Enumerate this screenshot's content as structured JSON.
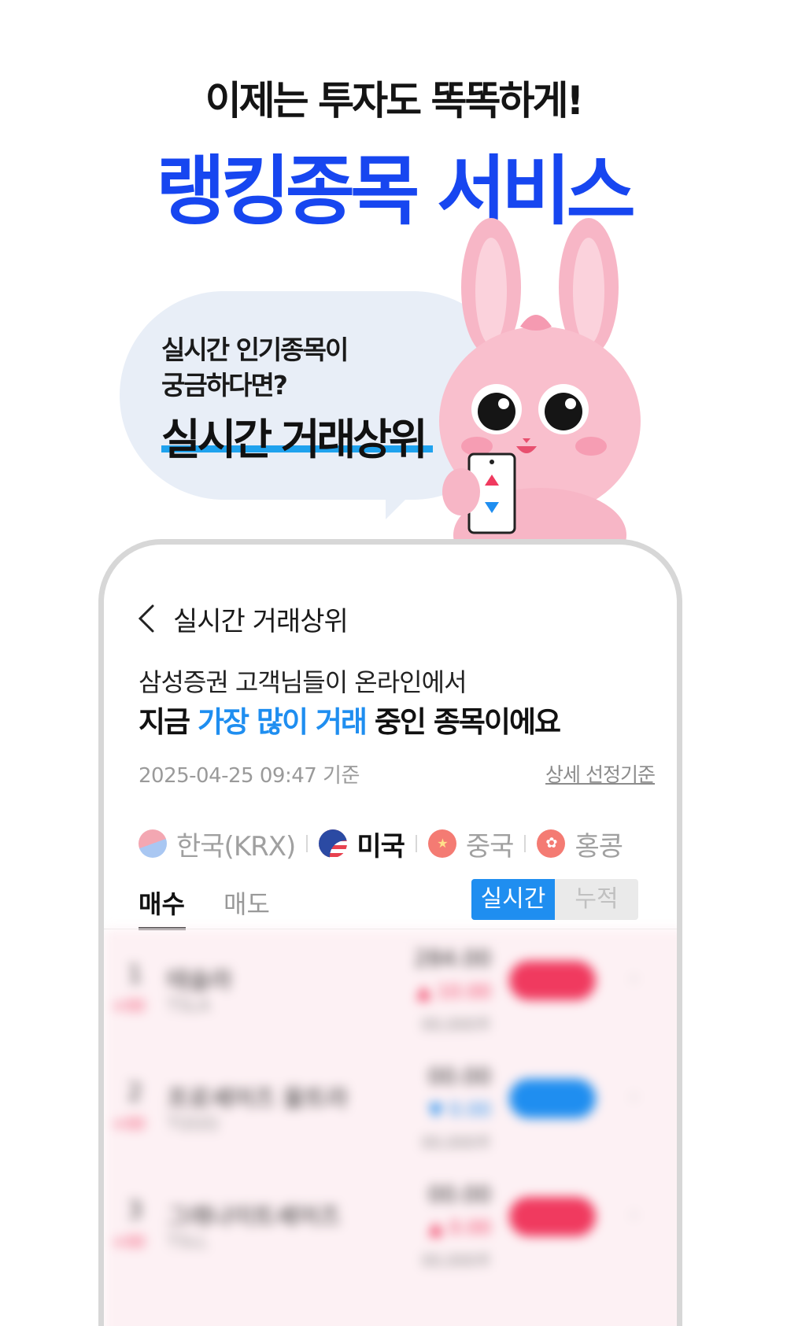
{
  "hero": {
    "headline": "이제는 투자도 똑똑하게!",
    "title": "랭킹종목 서비스"
  },
  "bubble": {
    "line1": "실시간 인기종목이",
    "line2": "궁금하다면?",
    "strong": "실시간 거래상위"
  },
  "screen": {
    "title": "실시간 거래상위",
    "desc_line1": "삼성증권 고객님들이 온라인에서",
    "desc_line2_a": "지금 ",
    "desc_line2_hl": "가장 많이 거래",
    "desc_line2_b": " 중인 종목이에요",
    "timestamp": "2025-04-25  09:47 기준",
    "criteria_link": "상세 선정기준",
    "markets": [
      {
        "label": "한국(KRX)",
        "active": false
      },
      {
        "label": "미국",
        "active": true
      },
      {
        "label": "중국",
        "active": false
      },
      {
        "label": "홍콩",
        "active": false
      }
    ],
    "tabs": {
      "buy": "매수",
      "sell": "매도"
    },
    "toggle": {
      "realtime": "실시간",
      "cumulative": "누적"
    }
  },
  "colors": {
    "brand_blue": "#1746f0",
    "accent_blue": "#1f8ef0",
    "up_red": "#f03a5f",
    "bubble_bg": "#e8eef7",
    "underline": "#1fa2ee"
  },
  "blurred_rows": [
    {
      "rank": "1",
      "rank_change": "+00",
      "name": "테슬라",
      "ticker": "TSLA",
      "price": "284.00",
      "change": "▲ 10.00",
      "volume": "00,000주",
      "direction": "up"
    },
    {
      "rank": "2",
      "rank_change": "+00",
      "name": "프로셰어즈 울트라",
      "ticker": "TQQQ",
      "price": "00.00",
      "change": "▼ 0.00",
      "volume": "00,000주",
      "direction": "down"
    },
    {
      "rank": "3",
      "rank_change": "+00",
      "name": "그래나이트셰어즈",
      "ticker": "TSLL",
      "price": "00.00",
      "change": "▲ 0.00",
      "volume": "00,000주",
      "direction": "up"
    }
  ]
}
